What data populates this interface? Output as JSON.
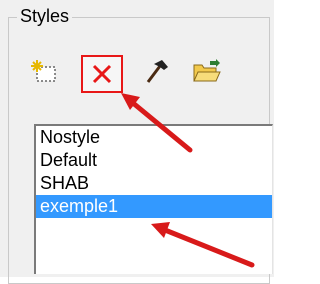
{
  "group": {
    "title": "Styles"
  },
  "toolbar": {
    "buttons": [
      {
        "icon": "new-style-icon"
      },
      {
        "icon": "delete-x-icon",
        "highlighted": true,
        "color": "#e81717"
      },
      {
        "icon": "hammer-icon"
      },
      {
        "icon": "open-folder-icon"
      }
    ]
  },
  "list": {
    "items": [
      "Nostyle",
      "Default",
      "SHAB",
      "exemple1"
    ],
    "selected_index": 3,
    "selection_color": "#3399ff"
  },
  "annotations": {
    "arrow_color": "#d81a1a",
    "arrow_count": 2
  }
}
